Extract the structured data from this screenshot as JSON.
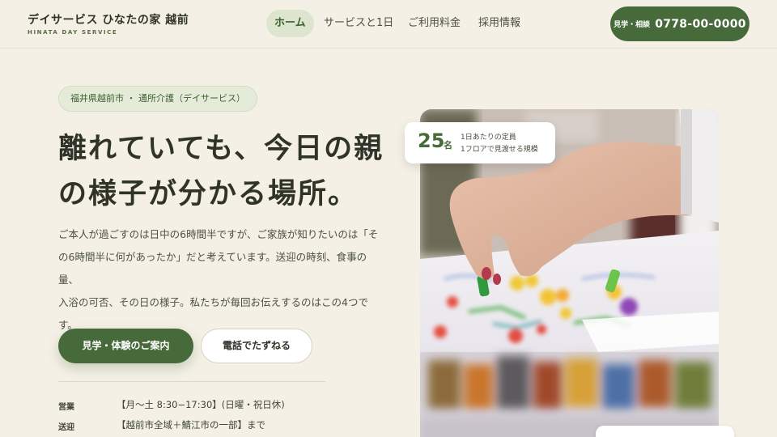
{
  "header": {
    "brand_title": "デイサービス ひなたの家 越前",
    "brand_sub": "HINATA DAY SERVICE",
    "nav": [
      {
        "label": "ホーム",
        "active": true
      },
      {
        "label": "サービスと1日",
        "active": false
      },
      {
        "label": "ご利用料金",
        "active": false
      },
      {
        "label": "採用情報",
        "active": false
      }
    ],
    "cta": {
      "prefix": "見学・相談",
      "phone": "0778-00-0000"
    }
  },
  "hero": {
    "chip": "福井県越前市 ・ 通所介護（デイサービス）",
    "title_line1": "離れていても、今日の親",
    "title_line2": "の様子が分かる場所。",
    "body_lines": [
      "ご本人が過ごすのは日中の6時間半ですが、ご家族が知りたいのは「そ",
      "の6時間半に何があったか」だと考えています。送迎の時刻、食事の量、",
      "入浴の可否、その日の様子。私たちが毎回お伝えするのはこの4つで",
      "す。"
    ],
    "primary_button": "見学・体験のご案内",
    "secondary_button": "電話でたずねる",
    "info": [
      {
        "key": "営業",
        "value": "【月〜土 8:30−17:30】(日曜・祝日休)"
      },
      {
        "key": "送迎",
        "value": "【越前市全域＋鯖江市の一部】まで"
      }
    ]
  },
  "stat": {
    "number": "25",
    "unit": "名",
    "line1": "1日あたりの定員",
    "line2": "1フロアで見渡せる規模"
  },
  "colors": {
    "background": "#f4f0e6",
    "accent": "#466a3a",
    "chip_bg": "#e4ebd9",
    "text": "#2f3328"
  }
}
